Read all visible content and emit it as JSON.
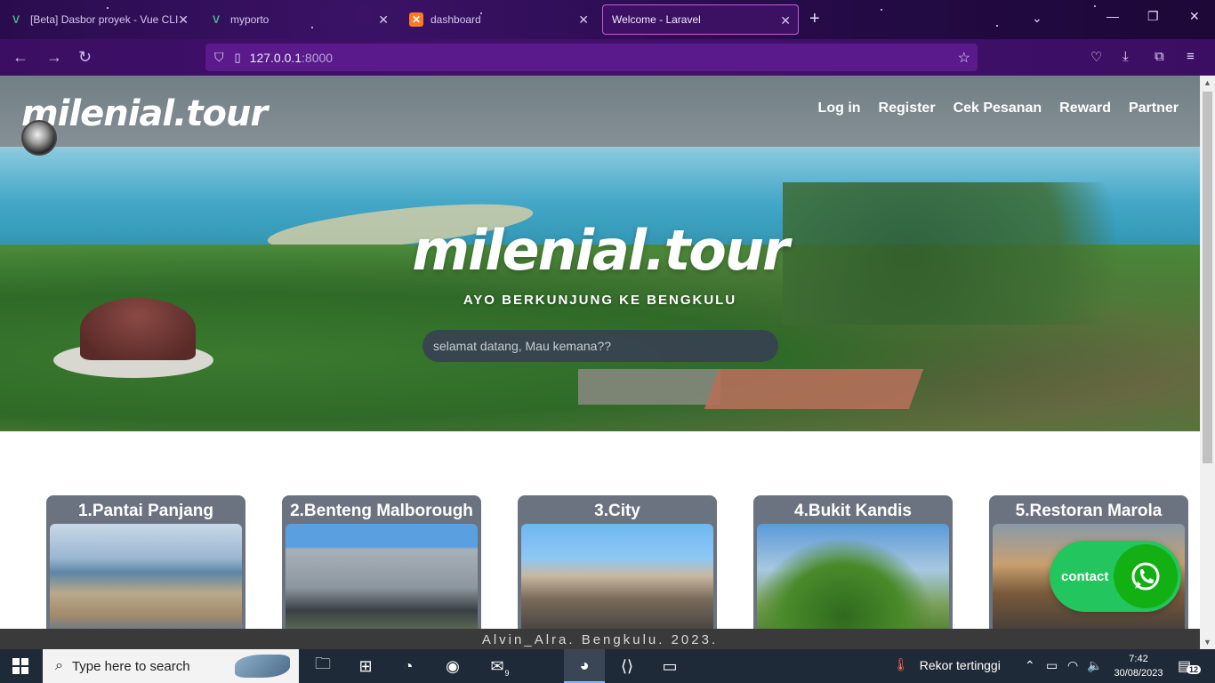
{
  "browser": {
    "tabs": [
      {
        "label": "[Beta] Dasbor proyek - Vue CLI",
        "icon": "vue-icon"
      },
      {
        "label": "myporto",
        "icon": "vue-icon"
      },
      {
        "label": "dashboard",
        "icon": "xampp-icon"
      },
      {
        "label": "Welcome - Laravel",
        "icon": "laravel-icon",
        "active": true
      }
    ],
    "url_host": "127.0.0.1",
    "url_port": ":8000"
  },
  "site": {
    "logo": "milenial.tour",
    "nav": [
      "Log in",
      "Register",
      "Cek Pesanan",
      "Reward",
      "Partner"
    ],
    "hero_title": "milenial.tour",
    "hero_subtitle": "AYO BERKUNJUNG KE BENGKULU",
    "search_placeholder": "selamat datang, Mau kemana??",
    "cards": [
      {
        "title": "1.Pantai Panjang"
      },
      {
        "title": "2.Benteng Malborough"
      },
      {
        "title": "3.City"
      },
      {
        "title": "4.Bukit Kandis"
      },
      {
        "title": "5.Restoran Marola"
      }
    ],
    "contact_label": "contact",
    "footer": "Alvin_Alra. Bengkulu. 2023."
  },
  "taskbar": {
    "search_placeholder": "Type here to search",
    "mail_badge": "9",
    "weather": "Rekor tertinggi",
    "time": "7:42",
    "date": "30/08/2023",
    "notifications": "12"
  },
  "colors": {
    "accent_purple": "#3b0e63",
    "contact_green": "#22c55e",
    "card_gray": "#6b7280"
  }
}
